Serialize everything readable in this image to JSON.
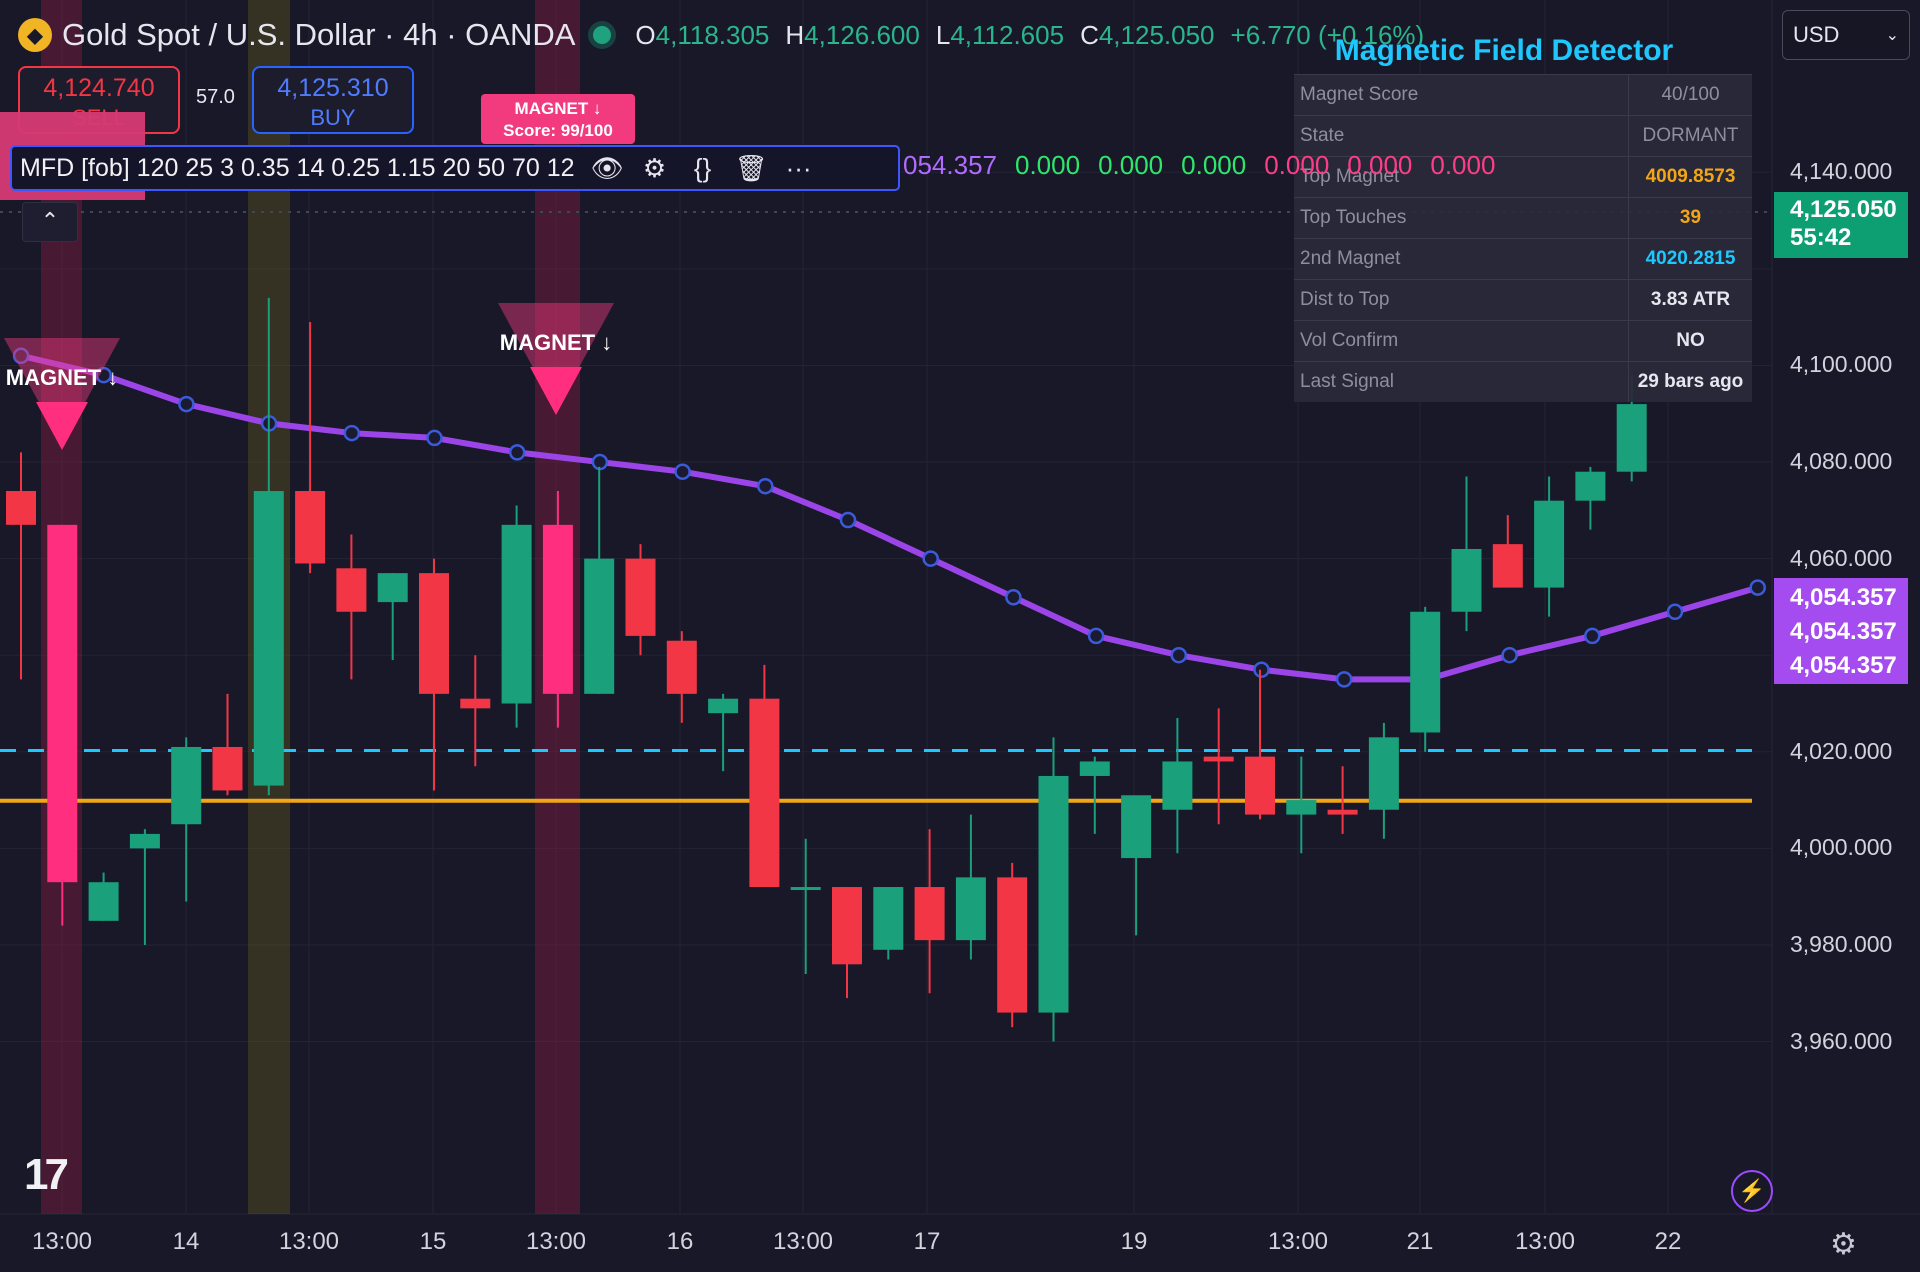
{
  "header": {
    "symbol": "Gold Spot / U.S. Dollar · 4h · OANDA",
    "ohlc": [
      {
        "k": "O",
        "v": "4,118.305"
      },
      {
        "k": "H",
        "v": "4,126.600"
      },
      {
        "k": "L",
        "v": "4,112.605"
      },
      {
        "k": "C",
        "v": "4,125.050"
      }
    ],
    "change": "+6.770 (+0.16%)"
  },
  "trade": {
    "sell_price": "4,124.740",
    "sell_label": "SELL",
    "spread": "57.0",
    "buy_price": "4,125.310",
    "buy_label": "BUY"
  },
  "badge": {
    "line1": "MAGNET ↓",
    "line2": "Score: 99/100"
  },
  "indicator": {
    "params": "MFD [fob] 120 25 3 0.35 14 0.25 1.15 20 50 70 12",
    "values": [
      {
        "text": "054.357",
        "color": "#b26bff"
      },
      {
        "text": "0.000",
        "color": "#2ee66b"
      },
      {
        "text": "0.000",
        "color": "#2ee66b"
      },
      {
        "text": "0.000",
        "color": "#2ee66b"
      },
      {
        "text": "0.000",
        "color": "#ff3d86"
      },
      {
        "text": "0.000",
        "color": "#ff3d86"
      },
      {
        "text": "0.000",
        "color": "#ff3d86"
      }
    ]
  },
  "currency": "USD",
  "panel": {
    "title": "Magnetic Field Detector",
    "rows": [
      {
        "label": "Magnet Score",
        "value": "40/100",
        "color": "#8e8e9e"
      },
      {
        "label": "State",
        "value": "DORMANT",
        "color": "#8e8e9e"
      },
      {
        "label": "Top Magnet",
        "value": "4009.8573",
        "color": "#f2a516"
      },
      {
        "label": "Top Touches",
        "value": "39",
        "color": "#f2a516"
      },
      {
        "label": "2nd Magnet",
        "value": "4020.2815",
        "color": "#1ec8ff"
      },
      {
        "label": "Dist to Top",
        "value": "3.83 ATR",
        "color": "#e6e6ee"
      },
      {
        "label": "Vol Confirm",
        "value": "NO",
        "color": "#e6e6ee"
      },
      {
        "label": "Last Signal",
        "value": "29 bars ago",
        "color": "#e6e6ee"
      }
    ]
  },
  "yaxis": {
    "labels": [
      "4,140.000",
      "4,100.000",
      "4,080.000",
      "4,060.000",
      "4,020.000",
      "4,000.000",
      "3,980.000",
      "3,960.000"
    ],
    "current_price": "4,125.050",
    "countdown": "55:42",
    "ma_tags": [
      "4,054.357",
      "4,054.357",
      "4,054.357"
    ]
  },
  "xaxis": {
    "labels": [
      "13:00",
      "14",
      "13:00",
      "15",
      "13:00",
      "16",
      "13:00",
      "17",
      "19",
      "13:00",
      "21",
      "13:00",
      "22"
    ]
  },
  "signals": [
    {
      "label": "MAGNET ↓"
    },
    {
      "label": "MAGNET ↓"
    }
  ],
  "chart_data": {
    "type": "candlestick",
    "ylim": [
      3945,
      4150
    ],
    "candles": [
      {
        "o": 4074,
        "h": 4082,
        "l": 4035,
        "c": 4067
      },
      {
        "o": 4067,
        "h": 4067,
        "l": 3984,
        "c": 3993
      },
      {
        "o": 3985,
        "h": 3995,
        "l": 3985,
        "c": 3993
      },
      {
        "o": 4000,
        "h": 4004,
        "l": 3980,
        "c": 4003
      },
      {
        "o": 4005,
        "h": 4023,
        "l": 3989,
        "c": 4021
      },
      {
        "o": 4021,
        "h": 4032,
        "l": 4011,
        "c": 4012
      },
      {
        "o": 4013,
        "h": 4114,
        "l": 4011,
        "c": 4074
      },
      {
        "o": 4074,
        "h": 4109,
        "l": 4057,
        "c": 4059
      },
      {
        "o": 4058,
        "h": 4065,
        "l": 4035,
        "c": 4049
      },
      {
        "o": 4051,
        "h": 4057,
        "l": 4039,
        "c": 4057
      },
      {
        "o": 4057,
        "h": 4060,
        "l": 4012,
        "c": 4032
      },
      {
        "o": 4031,
        "h": 4040,
        "l": 4017,
        "c": 4029
      },
      {
        "o": 4030,
        "h": 4071,
        "l": 4025,
        "c": 4067
      },
      {
        "o": 4067,
        "h": 4074,
        "l": 4025,
        "c": 4032
      },
      {
        "o": 4032,
        "h": 4079,
        "l": 4032,
        "c": 4060
      },
      {
        "o": 4060,
        "h": 4063,
        "l": 4040,
        "c": 4044
      },
      {
        "o": 4043,
        "h": 4045,
        "l": 4026,
        "c": 4032
      },
      {
        "o": 4028,
        "h": 4032,
        "l": 4016,
        "c": 4031
      },
      {
        "o": 4031,
        "h": 4038,
        "l": 3994,
        "c": 3992
      },
      {
        "o": 3992,
        "h": 4002,
        "l": 3974,
        "c": 3992
      },
      {
        "o": 3992,
        "h": 3992,
        "l": 3969,
        "c": 3976
      },
      {
        "o": 3979,
        "h": 3992,
        "l": 3977,
        "c": 3992
      },
      {
        "o": 3992,
        "h": 4004,
        "l": 3970,
        "c": 3981
      },
      {
        "o": 3981,
        "h": 4007,
        "l": 3977,
        "c": 3994
      },
      {
        "o": 3994,
        "h": 3997,
        "l": 3963,
        "c": 3966
      },
      {
        "o": 3966,
        "h": 4023,
        "l": 3960,
        "c": 4015
      },
      {
        "o": 4015,
        "h": 4019,
        "l": 4003,
        "c": 4018
      },
      {
        "o": 3998,
        "h": 4009,
        "l": 3982,
        "c": 4011
      },
      {
        "o": 4008,
        "h": 4027,
        "l": 3999,
        "c": 4018
      },
      {
        "o": 4019,
        "h": 4029,
        "l": 4005,
        "c": 4018
      },
      {
        "o": 4019,
        "h": 4037,
        "l": 4006,
        "c": 4007
      },
      {
        "o": 4007,
        "h": 4019,
        "l": 3999,
        "c": 4010
      },
      {
        "o": 4008,
        "h": 4017,
        "l": 4003,
        "c": 4007
      },
      {
        "o": 4008,
        "h": 4026,
        "l": 4002,
        "c": 4023
      },
      {
        "o": 4024,
        "h": 4050,
        "l": 4020,
        "c": 4049
      },
      {
        "o": 4049,
        "h": 4077,
        "l": 4045,
        "c": 4062
      },
      {
        "o": 4063,
        "h": 4069,
        "l": 4055,
        "c": 4054
      },
      {
        "o": 4054,
        "h": 4077,
        "l": 4048,
        "c": 4072
      },
      {
        "o": 4072,
        "h": 4079,
        "l": 4066,
        "c": 4078
      },
      {
        "o": 4078,
        "h": 4098,
        "l": 4076,
        "c": 4092
      }
    ],
    "ma_values": [
      4102,
      4098,
      4092,
      4088,
      4086,
      4085,
      4082,
      4080,
      4078,
      4075,
      4068,
      4060,
      4052,
      4044,
      4040,
      4037,
      4035,
      4035,
      4040,
      4044,
      4049,
      4054
    ],
    "levels": [
      {
        "name": "Top Magnet",
        "value": 4009.8573,
        "color": "#f2a516"
      },
      {
        "name": "2nd Magnet",
        "value": 4020.2815,
        "color": "#1ec8ff"
      }
    ]
  }
}
